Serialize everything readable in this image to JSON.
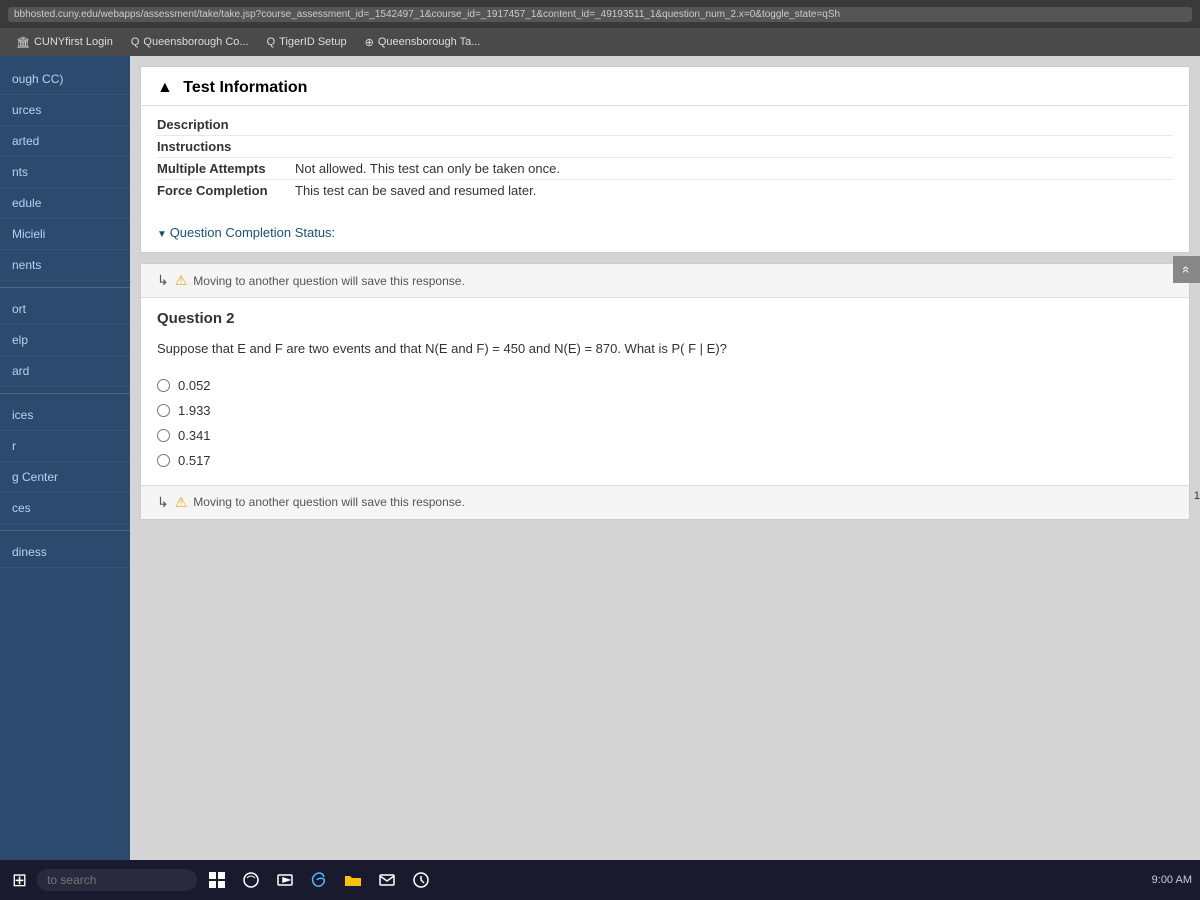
{
  "browser": {
    "url": "bbhosted.cuny.edu/webapps/assessment/take/take.jsp?course_assessment_id=_1542497_1&course_id=_1917457_1&content_id=_49193511_1&question_num_2.x=0&toggle_state=qSh",
    "bookmarks": [
      {
        "id": "cuny",
        "label": "CUNYfirst Login",
        "icon": "🏛"
      },
      {
        "id": "queens",
        "label": "Queensborough Co...",
        "icon": "Q"
      },
      {
        "id": "tiger",
        "label": "TigerID Setup",
        "icon": "Q"
      },
      {
        "id": "qta",
        "label": "Queensborough Ta...",
        "icon": "⊕"
      }
    ]
  },
  "sidebar": {
    "items": [
      {
        "id": "course-cc",
        "label": "ough CC)"
      },
      {
        "id": "resources",
        "label": "urces"
      },
      {
        "id": "started",
        "label": "arted"
      },
      {
        "id": "announcements",
        "label": "nts"
      },
      {
        "id": "schedule",
        "label": "edule"
      },
      {
        "id": "micieli",
        "label": "Micieli"
      },
      {
        "id": "assignments",
        "label": "nents"
      },
      {
        "id": "port",
        "label": "ort"
      },
      {
        "id": "help",
        "label": "elp"
      },
      {
        "id": "card",
        "label": "ard"
      },
      {
        "id": "services",
        "label": "ices"
      },
      {
        "id": "r",
        "label": "r"
      },
      {
        "id": "learning-center",
        "label": "g Center"
      },
      {
        "id": "ces",
        "label": "ces"
      },
      {
        "id": "wellness",
        "label": "diness"
      }
    ]
  },
  "test_info": {
    "heading": "Test Information",
    "rows": [
      {
        "label": "Description",
        "value": ""
      },
      {
        "label": "Instructions",
        "value": ""
      },
      {
        "label": "Multiple Attempts",
        "value": "Not allowed. This test can only be taken once."
      },
      {
        "label": "Force Completion",
        "value": "This test can be saved and resumed later."
      }
    ]
  },
  "completion_status": {
    "label": "Question Completion Status:"
  },
  "question": {
    "number": "Question 2",
    "save_warning_top": "Moving to another question will save this response.",
    "save_warning_bottom": "Moving to another question will save this response.",
    "text": "Suppose that E and F are two events and that N(E and F) = 450 and N(E) = 870. What is P( F | E)?",
    "choices": [
      {
        "id": "c1",
        "value": "0.052",
        "label": "0.052"
      },
      {
        "id": "c2",
        "value": "1.933",
        "label": "1.933"
      },
      {
        "id": "c3",
        "value": "0.341",
        "label": "0.341"
      },
      {
        "id": "c4",
        "value": "0.517",
        "label": "0.517"
      }
    ]
  },
  "nav": {
    "back_label": "«",
    "forward_label": "»",
    "page_num": "1"
  },
  "taskbar": {
    "search_placeholder": "to search"
  }
}
